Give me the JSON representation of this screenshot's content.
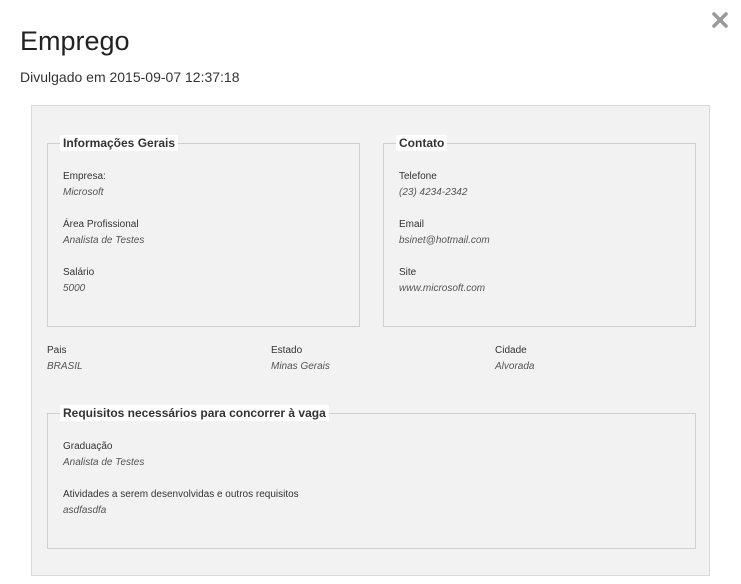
{
  "dialog": {
    "title": "Emprego",
    "published": "Divulgado em 2015-09-07 12:37:18",
    "close_icon": "close-icon"
  },
  "general_info": {
    "legend": "Informações Gerais",
    "company_label": "Empresa:",
    "company_value": "Microsoft",
    "area_label": "Área Profissional",
    "area_value": "Analista de Testes",
    "salary_label": "Salário",
    "salary_value": "5000"
  },
  "contact": {
    "legend": "Contato",
    "phone_label": "Telefone",
    "phone_value": "(23) 4234-2342",
    "email_label": "Email",
    "email_value": "bsinet@hotmail.com",
    "site_label": "Site",
    "site_value": "www.microsoft.com"
  },
  "location": {
    "country_label": "Pais",
    "country_value": "BRASIL",
    "state_label": "Estado",
    "state_value": "Minas Gerais",
    "city_label": "Cidade",
    "city_value": "Alvorada"
  },
  "requirements": {
    "legend": "Requisitos necessários para concorrer à vaga",
    "degree_label": "Graduação",
    "degree_value": "Analista de Testes",
    "activities_label": "Atividades a serem desenvolvidas e outros requisitos",
    "activities_value": "asdfasdfa"
  },
  "colors": {
    "panel_background": "#f2f2f2",
    "border": "#d0d0d0"
  }
}
